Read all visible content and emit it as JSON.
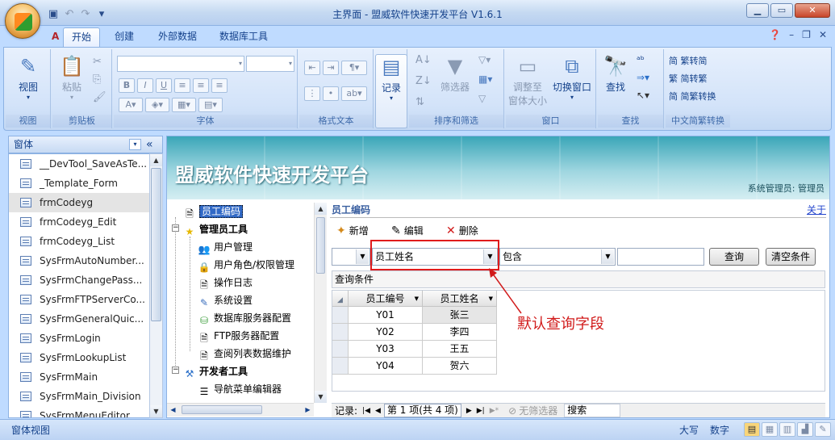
{
  "window": {
    "title": "主界面 - 盟威软件快速开发平台 V1.6.1"
  },
  "ribbon_tabs": [
    "开始",
    "创建",
    "外部数据",
    "数据库工具"
  ],
  "ribbon_groups": {
    "view": {
      "label": "视图",
      "btn": "视图"
    },
    "clipboard": {
      "label": "剪贴板",
      "paste": "粘贴"
    },
    "font": {
      "label": "字体"
    },
    "rich_text": {
      "label": "格式文本"
    },
    "records": {
      "btn": "记录"
    },
    "sort_filter": {
      "label": "排序和筛选",
      "filter": "筛选器"
    },
    "window": {
      "label": "窗口",
      "fit": "调整至",
      "fit2": "窗体大小",
      "switch": "切换窗口"
    },
    "find": {
      "label": "查找",
      "btn": "查找"
    },
    "convert": {
      "label": "中文简繁转换",
      "t2s": "繁转简",
      "s2t": "简转繁",
      "conv": "简繁转换"
    }
  },
  "left_panel": {
    "header": "窗体",
    "items": [
      "__DevTool_SaveAsTe...",
      "_Template_Form",
      "frmCodeyg",
      "frmCodeyg_Edit",
      "frmCodeyg_List",
      "SysFrmAutoNumber...",
      "SysFrmChangePass...",
      "SysFrmFTPServerCo...",
      "SysFrmGeneralQuic...",
      "SysFrmLogin",
      "SysFrmLookupList",
      "SysFrmMain",
      "SysFrmMain_Division",
      "SysFrmMenuEditor"
    ]
  },
  "banner": {
    "title": "盟威软件快速开发平台",
    "user": "系统管理员: 管理员"
  },
  "tree": {
    "emp_code": "员工编码",
    "admin_tools": "管理员工具",
    "user_mgmt": "用户管理",
    "roles": "用户角色/权限管理",
    "log": "操作日志",
    "settings": "系统设置",
    "db_config": "数据库服务器配置",
    "ftp_config": "FTP服务器配置",
    "list_maint": "查阅列表数据维护",
    "dev_tools": "开发者工具",
    "nav_editor": "导航菜单编辑器"
  },
  "content": {
    "title": "员工编码",
    "close": "关于",
    "toolbar": {
      "add": "新增",
      "edit": "编辑",
      "delete": "删除"
    },
    "filter": {
      "field": "员工姓名",
      "op": "包含",
      "value": "",
      "query_btn": "查询",
      "clear_btn": "清空条件"
    },
    "query_cond_label": "查询条件",
    "grid": {
      "columns": [
        "员工编号",
        "员工姓名"
      ],
      "rows": [
        [
          "Y01",
          "张三"
        ],
        [
          "Y02",
          "李四"
        ],
        [
          "Y03",
          "王五"
        ],
        [
          "Y04",
          "贺六"
        ]
      ]
    },
    "annotation": "默认查询字段",
    "nav": {
      "label": "记录:",
      "pos": "第 1 项(共 4 项)",
      "no_filter": "无筛选器",
      "search": "搜索"
    }
  },
  "status": {
    "left": "窗体视图",
    "caps": "大写",
    "num": "数字"
  }
}
